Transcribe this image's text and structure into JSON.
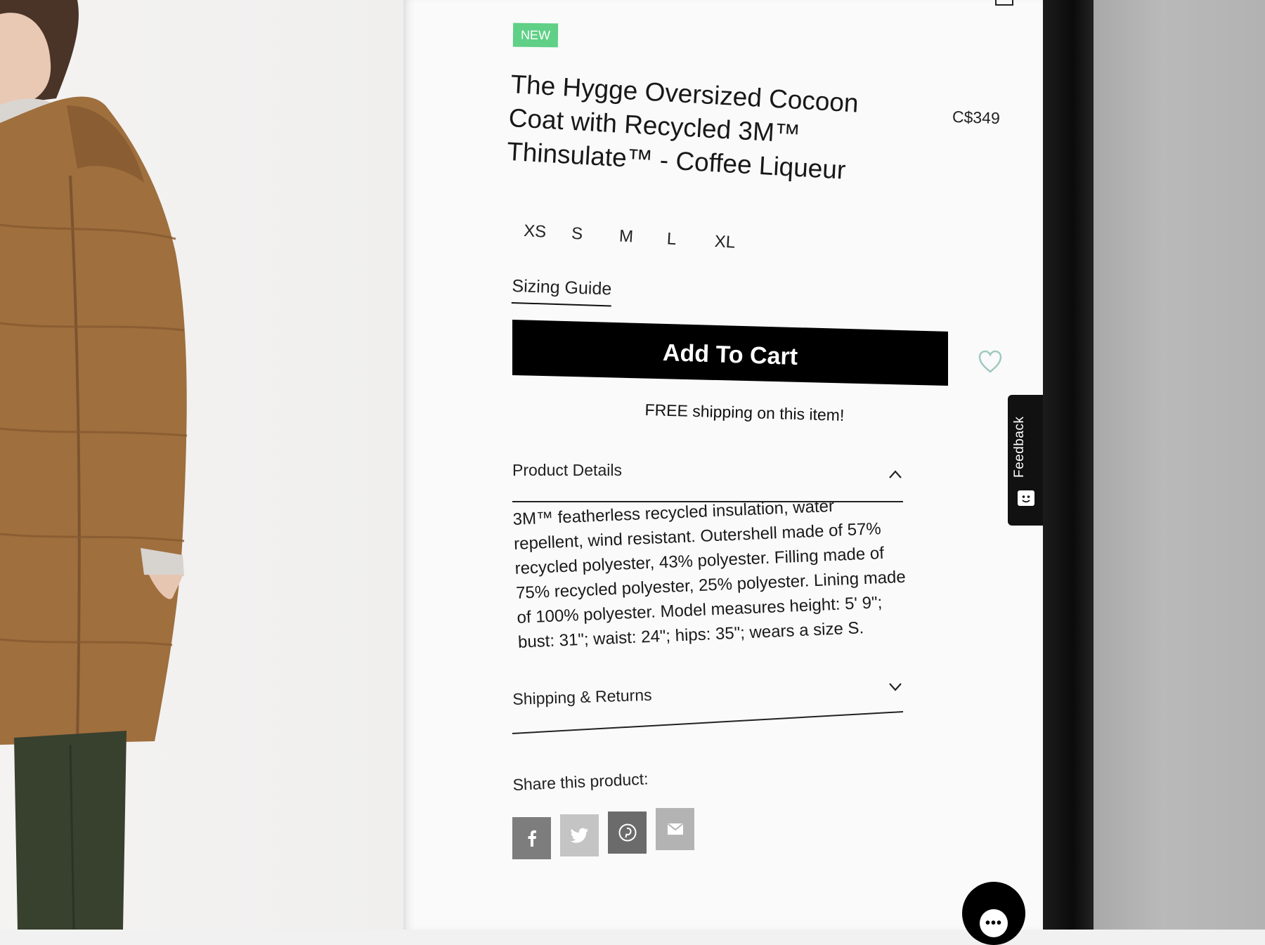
{
  "product": {
    "badge": "NEW",
    "title": "The Hygge Oversized Cocoon Coat with Recycled 3M™ Thinsulate™ - Coffee Liqueur",
    "price": "C$349",
    "sizes": [
      "XS",
      "S",
      "M",
      "L",
      "XL"
    ],
    "sizing_guide_label": "Sizing Guide",
    "add_to_cart_label": "Add To Cart",
    "free_shipping_note": "FREE shipping on this item!"
  },
  "accordion": {
    "details_label": "Product Details",
    "details_body": "3M™ featherless recycled insulation, water repellent, wind resistant. Outershell made of 57% recycled polyester, 43% polyester. Filling made of 75% recycled polyester, 25% polyester. Lining made of 100% polyester. Model measures height: 5' 9\"; bust: 31\"; waist: 24\"; hips: 35\"; wears a size S.",
    "shipping_label": "Shipping & Returns"
  },
  "share": {
    "label": "Share this product:",
    "buttons": [
      {
        "icon": "facebook-icon",
        "color": "#7d7d7d"
      },
      {
        "icon": "twitter-icon",
        "color": "#c4c4c4"
      },
      {
        "icon": "pinterest-icon",
        "color": "#6b6b6b"
      },
      {
        "icon": "email-icon",
        "color": "#b3b3b3"
      }
    ]
  },
  "feedback": {
    "label": "Feedback"
  },
  "chat": {
    "icon": "chat-icon",
    "glyph": "•••"
  },
  "colors": {
    "badge": "#5fd086",
    "heart": "#9fc9c0",
    "button": "#000000"
  }
}
